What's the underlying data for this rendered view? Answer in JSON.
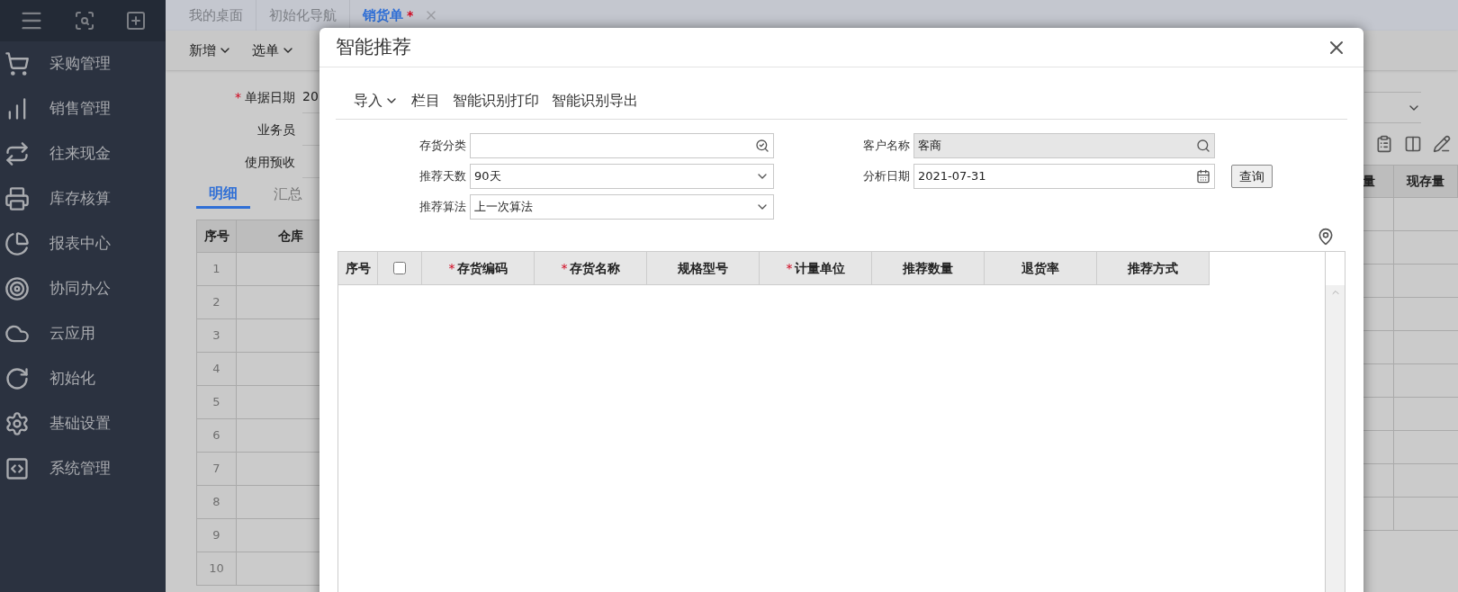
{
  "sidebar": {
    "items": [
      {
        "label": "采购管理"
      },
      {
        "label": "销售管理"
      },
      {
        "label": "往来现金"
      },
      {
        "label": "库存核算"
      },
      {
        "label": "报表中心"
      },
      {
        "label": "协同办公"
      },
      {
        "label": "云应用"
      },
      {
        "label": "初始化"
      },
      {
        "label": "基础设置"
      },
      {
        "label": "系统管理"
      }
    ]
  },
  "tabs": [
    {
      "label": "我的桌面",
      "selected": false
    },
    {
      "label": "初始化导航",
      "selected": false
    },
    {
      "label": "销货单",
      "selected": true,
      "mark": "*"
    }
  ],
  "toolbar": [
    {
      "label": "新增"
    },
    {
      "label": "选单"
    }
  ],
  "form": {
    "fields": [
      {
        "label": "单据日期",
        "mark": "*",
        "value": "20"
      },
      {
        "label": "业务员"
      },
      {
        "label": "使用预收"
      }
    ]
  },
  "detail_tabs": [
    {
      "label": "明细",
      "selected": true
    },
    {
      "label": "汇总",
      "selected": false
    }
  ],
  "grid": {
    "columns": [
      "序号",
      "仓库"
    ],
    "rows": [
      "1",
      "2",
      "3",
      "4",
      "5",
      "6",
      "7",
      "8",
      "9",
      "10"
    ],
    "right_columns": [
      "量",
      "现存量"
    ]
  },
  "dialog": {
    "title": "智能推荐",
    "toolbar": [
      {
        "label": "导入",
        "kind": "dropdown"
      },
      {
        "label": "栏目",
        "kind": "button"
      },
      {
        "label": "智能识别打印",
        "kind": "button"
      },
      {
        "label": "智能识别导出",
        "kind": "button"
      }
    ],
    "filters_left": [
      {
        "label": "存货分类",
        "kind": "lookup",
        "disabled": false
      },
      {
        "label": "推荐天数",
        "kind": "select",
        "value": "90天",
        "disabled": false
      },
      {
        "label": "推荐算法",
        "kind": "select",
        "value": "上一次算法",
        "disabled": false
      }
    ],
    "filters_right": [
      {
        "label": "客户名称",
        "kind": "search",
        "value": "客商",
        "disabled": true
      },
      {
        "label": "分析日期",
        "kind": "date",
        "value": "2021-07-31",
        "disabled": false
      }
    ],
    "query_button": "查询",
    "table": {
      "columns": [
        {
          "label": "序号",
          "kind": "text"
        },
        {
          "kind": "checkbox",
          "checked": false
        },
        {
          "label": "存货编码",
          "kind": "text",
          "mark": "*"
        },
        {
          "label": "存货名称",
          "kind": "text",
          "mark": "*"
        },
        {
          "label": "规格型号",
          "kind": "text"
        },
        {
          "label": "计量单位",
          "kind": "text",
          "mark": "*"
        },
        {
          "label": "推荐数量",
          "kind": "text"
        },
        {
          "label": "退货率",
          "kind": "text"
        },
        {
          "label": "推荐方式",
          "kind": "text"
        }
      ]
    }
  }
}
